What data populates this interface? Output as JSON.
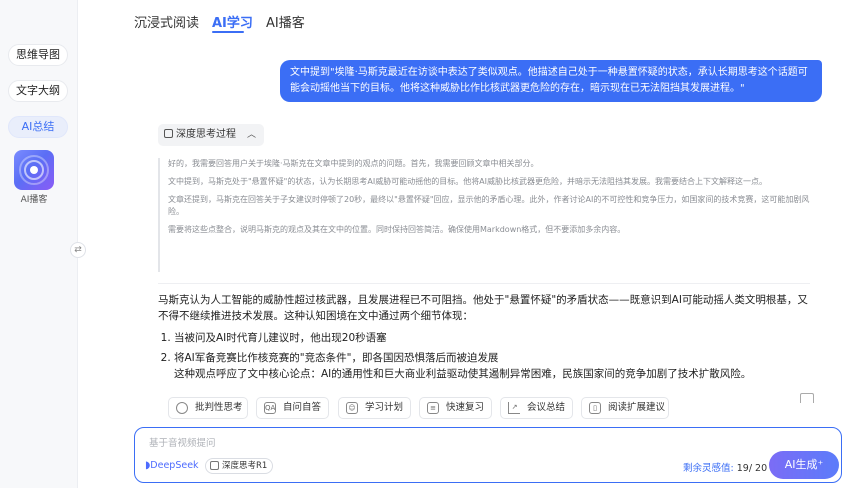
{
  "sidebar": {
    "items": [
      {
        "label": "思维导图"
      },
      {
        "label": "文字大纲"
      },
      {
        "label": "AI总结"
      }
    ],
    "podcast_label": "AI播客",
    "collapse_icon": "⇄"
  },
  "tabs": [
    {
      "label": "沉浸式阅读"
    },
    {
      "label": "AI学习"
    },
    {
      "label": "AI播客"
    }
  ],
  "chat": {
    "user_message": "文中提到\"埃隆·马斯克最近在访谈中表达了类似观点。他描述自己处于一种悬置怀疑的状态，承认长期思考这个话题可能会动摇他当下的目标。他将这种威胁比作比核武器更危险的存在，暗示现在已无法阻挡其发展进程。\"",
    "think_toggle": "深度思考过程",
    "thinking": [
      "好的，我需要回答用户关于埃隆·马斯克在文章中提到的观点的问题。首先，我需要回顾文章中相关部分。",
      "文中提到，马斯克处于\"悬置怀疑\"的状态，认为长期思考AI威胁可能动摇他的目标。他将AI威胁比核武器更危险，并暗示无法阻挡其发展。我需要结合上下文解释这一点。",
      "文章还提到，马斯克在回答关于子女建议时停顿了20秒，最终以\"悬置怀疑\"回应，显示他的矛盾心理。此外，作者讨论AI的不可控性和竞争压力，如国家间的技术竞赛，这可能加剧风险。",
      "需要将这些点整合，说明马斯克的观点及其在文中的位置。同时保持回答简洁。确保使用Markdown格式，但不要添加多余内容。"
    ],
    "answer_intro": "马斯克认为人工智能的威胁性超过核武器，且发展进程已不可阻挡。他处于\"悬置怀疑\"的矛盾状态——既意识到AI可能动摇人类文明根基，又不得不继续推进技术发展。这种认知困境在文中通过两个细节体现：",
    "answer_points": [
      {
        "text": "当被问及AI时代育儿建议时，他出现20秒语塞",
        "sub": ""
      },
      {
        "text": "将AI军备竞赛比作核竞赛的\"竞态条件\"，即各国因恐惧落后而被迫发展",
        "sub": "这种观点呼应了文中核心论点：AI的通用性和巨大商业利益驱动使其遏制异常困难，民族国家间的竞争加剧了技术扩散风险。"
      }
    ]
  },
  "actions": [
    {
      "label": "批判性思考",
      "icon": "brain-icon"
    },
    {
      "label": "自问自答",
      "icon": "qa-icon"
    },
    {
      "label": "学习计划",
      "icon": "plan-icon"
    },
    {
      "label": "快速复习",
      "icon": "review-icon"
    },
    {
      "label": "会议总结",
      "icon": "chart-icon"
    },
    {
      "label": "阅读扩展建议",
      "icon": "book-icon"
    }
  ],
  "input": {
    "placeholder": "基于音视频提问",
    "model": "DeepSeek",
    "mode_badge": "深度思考R1",
    "quota_label": "剩余灵感值:",
    "quota_value": "19/ 20",
    "generate_label": "AI生成⁺"
  },
  "colors": {
    "accent": "#3b6ef5",
    "deepseek": "#4d6bfe"
  }
}
